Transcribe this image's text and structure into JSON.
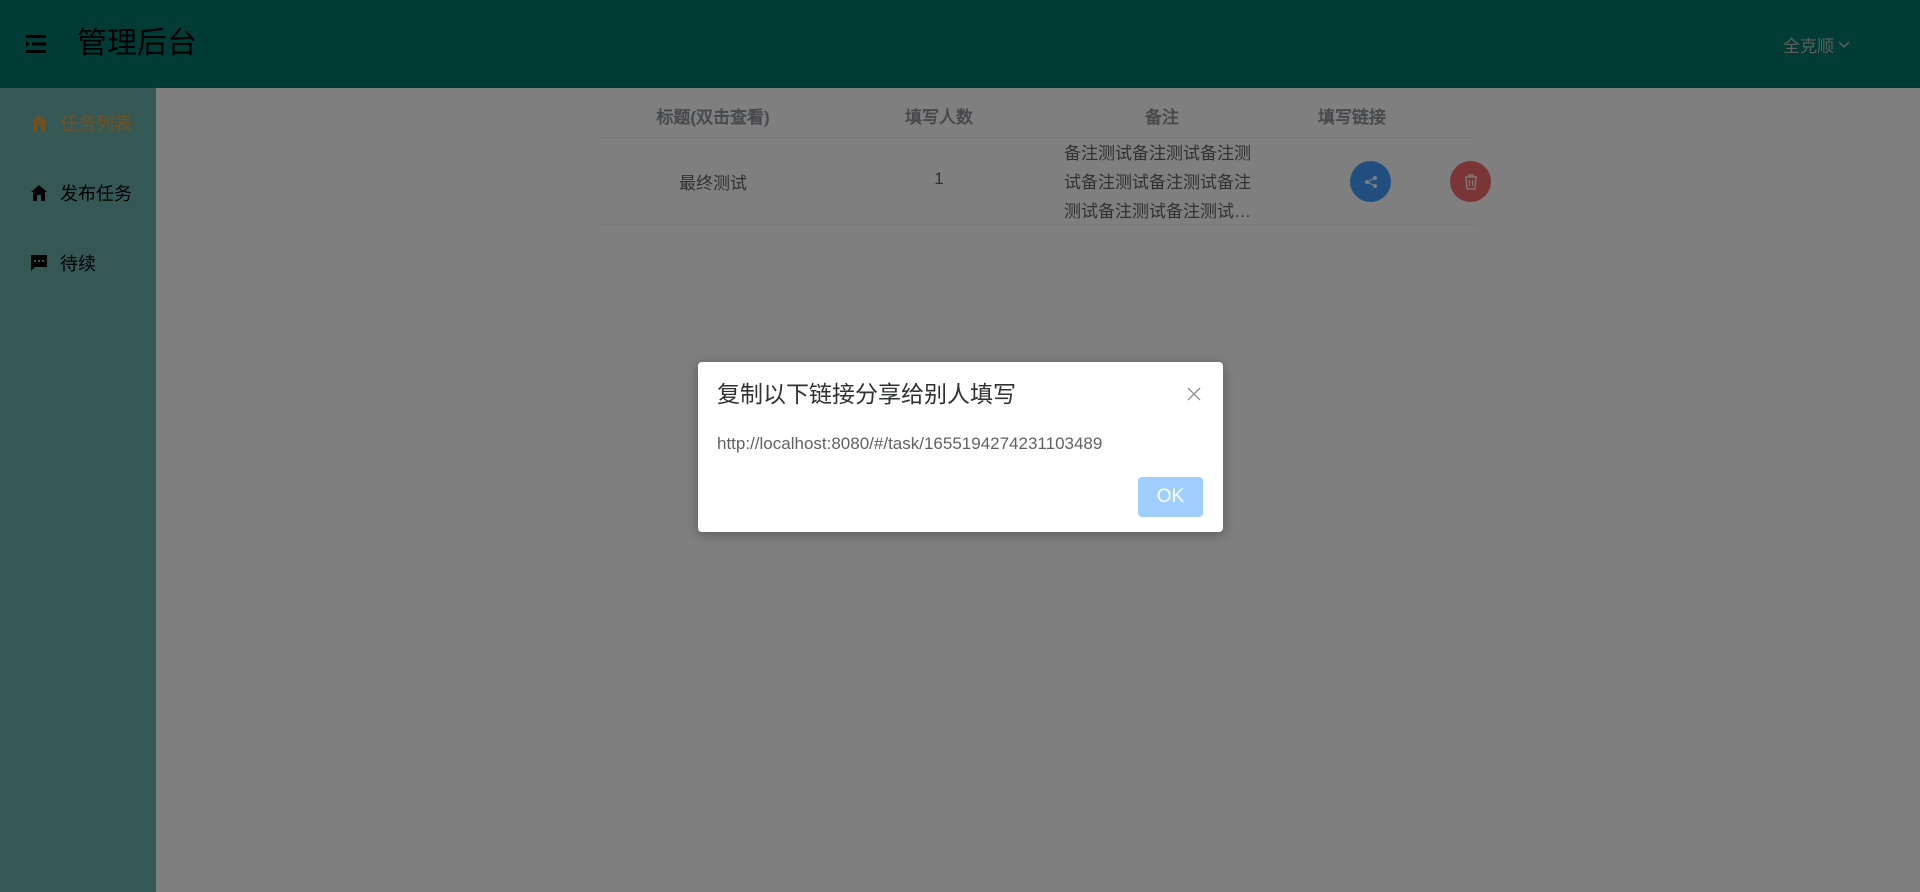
{
  "header": {
    "title": "管理后台",
    "user_name": "全克顺"
  },
  "sidebar": {
    "items": [
      {
        "label": "任务列表",
        "icon": "home-icon",
        "active": true
      },
      {
        "label": "发布任务",
        "icon": "home-icon",
        "active": false
      },
      {
        "label": "待续",
        "icon": "message-icon",
        "active": false
      }
    ]
  },
  "table": {
    "columns": [
      "标题(双击查看)",
      "填写人数",
      "备注",
      "填写链接"
    ],
    "rows": [
      {
        "title": "最终测试",
        "count": "1",
        "remark": "备注测试备注测试备注测试备注测试备注测试备注测试备注测试备注测试备注测试备注测试"
      }
    ]
  },
  "dialog": {
    "title": "复制以下链接分享给别人填写",
    "message": "http://localhost:8080/#/task/1655194274231103489",
    "ok_label": "OK"
  },
  "colors": {
    "header_bg": "#00796b",
    "sidebar_bg": "#6db1a8",
    "active_item": "#e6a23c",
    "share_button": "#409eff",
    "delete_button": "#f56c6c",
    "ok_button": "#a0cfff"
  }
}
